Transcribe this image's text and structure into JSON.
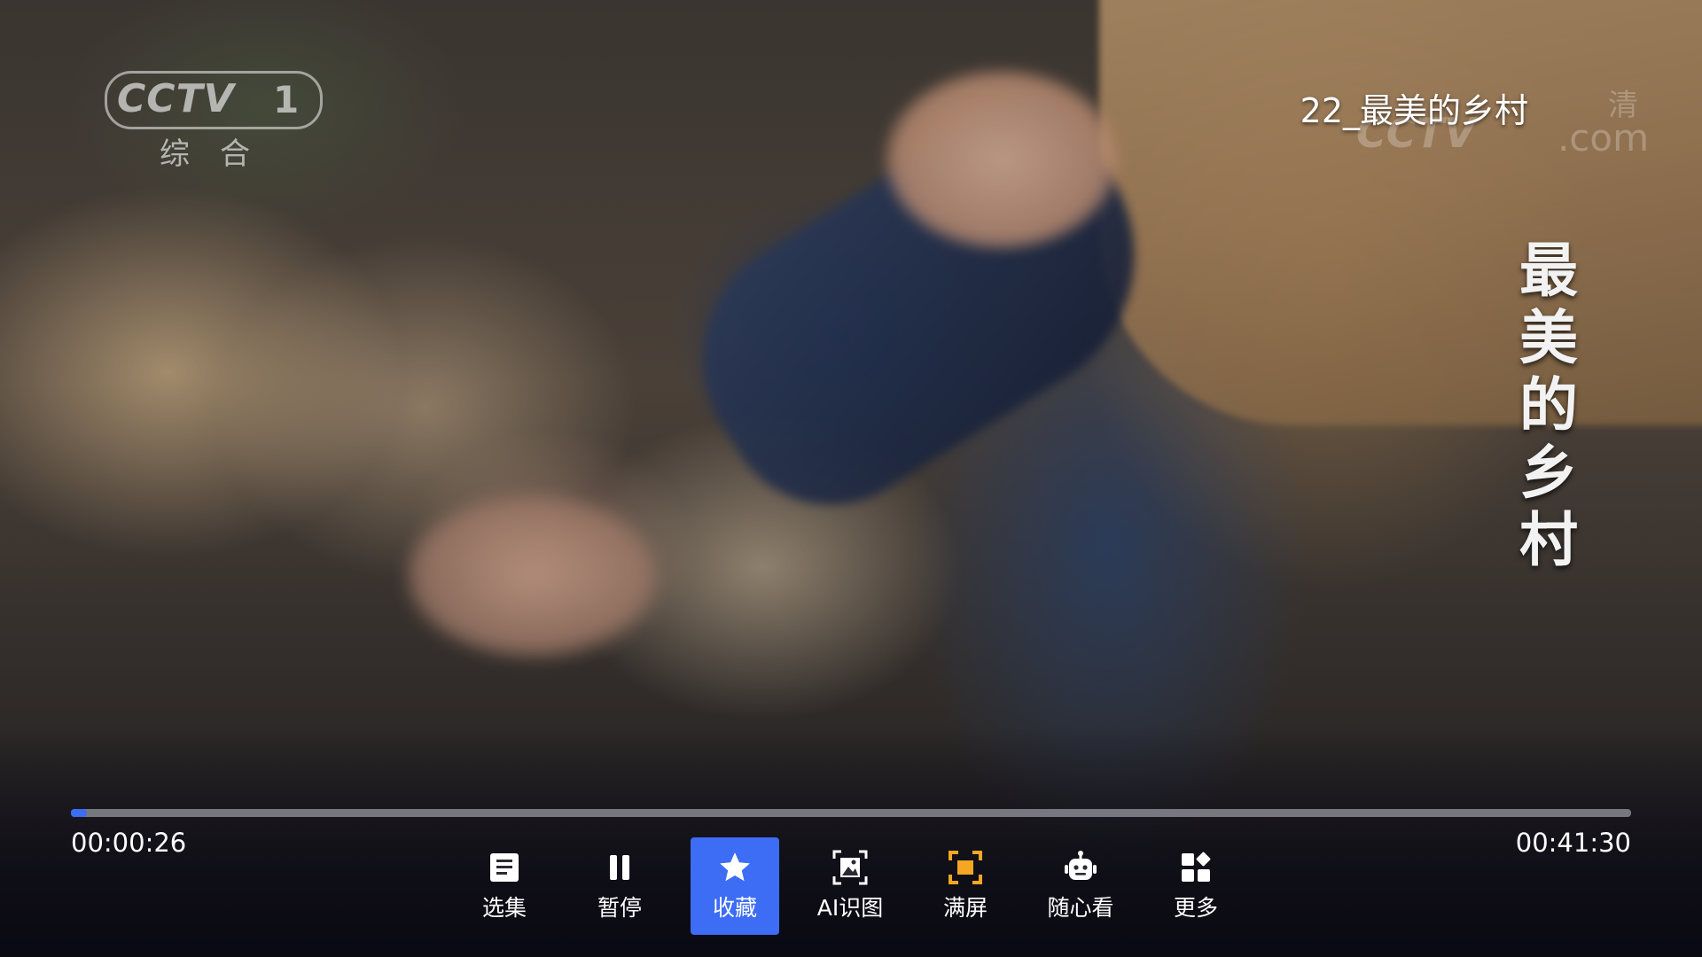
{
  "channel": {
    "logo_text": "CCTV",
    "number": "1",
    "subtitle": "综合"
  },
  "watermark": {
    "text": "CCTV",
    "domain": ".com",
    "quality": "清"
  },
  "episode": {
    "title": "22_最美的乡村",
    "caption": "最美的乡村"
  },
  "player": {
    "current_time": "00:00:26",
    "total_time": "00:41:30",
    "progress": 0.0104,
    "accent_color": "#3d6cf5"
  },
  "controls": [
    {
      "id": "episodes",
      "label": "选集",
      "icon": "list-icon",
      "active": false
    },
    {
      "id": "pause",
      "label": "暂停",
      "icon": "pause-icon",
      "active": false
    },
    {
      "id": "favorite",
      "label": "收藏",
      "icon": "star-icon",
      "active": true
    },
    {
      "id": "ai",
      "label": "AI识图",
      "icon": "image-scan-icon",
      "active": false
    },
    {
      "id": "fullscreen",
      "label": "满屏",
      "icon": "fullscreen-icon",
      "active": false
    },
    {
      "id": "random",
      "label": "随心看",
      "icon": "robot-icon",
      "active": false
    },
    {
      "id": "more",
      "label": "更多",
      "icon": "grid-icon",
      "active": false
    }
  ]
}
